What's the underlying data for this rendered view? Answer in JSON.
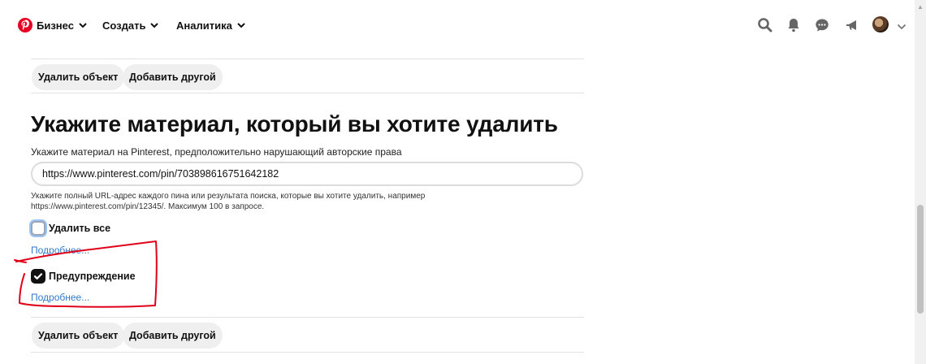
{
  "header": {
    "nav": [
      {
        "label": "Бизнес"
      },
      {
        "label": "Создать"
      },
      {
        "label": "Аналитика"
      }
    ],
    "icons": [
      "search-icon",
      "bell-icon",
      "messages-icon",
      "megaphone-icon",
      "avatar",
      "chevron-down-icon"
    ]
  },
  "top_actions": {
    "remove_label": "Удалить объект",
    "add_label": "Добавить другой"
  },
  "section": {
    "title": "Укажите материал, который вы хотите удалить",
    "field_label": "Укажите материал на Pinterest, предположительно нарушающий авторские права",
    "url_value": "https://www.pinterest.com/pin/703898616751642182",
    "hint": "Укажите полный URL-адрес каждого пина или результата поиска, которые вы хотите удалить, например https://www.pinterest.com/pin/12345/. Максимум 100 в запросе.",
    "options": [
      {
        "label": "Удалить все",
        "checked": false,
        "more": "Подробнее..."
      },
      {
        "label": "Предупреждение",
        "checked": true,
        "more": "Подробнее..."
      }
    ]
  },
  "bottom_actions": {
    "remove_label": "Удалить объект",
    "add_label": "Добавить другой"
  },
  "colors": {
    "brand": "#e60023",
    "link": "#3478c6",
    "annotation": "#e0001a",
    "button_bg": "#efefef"
  }
}
